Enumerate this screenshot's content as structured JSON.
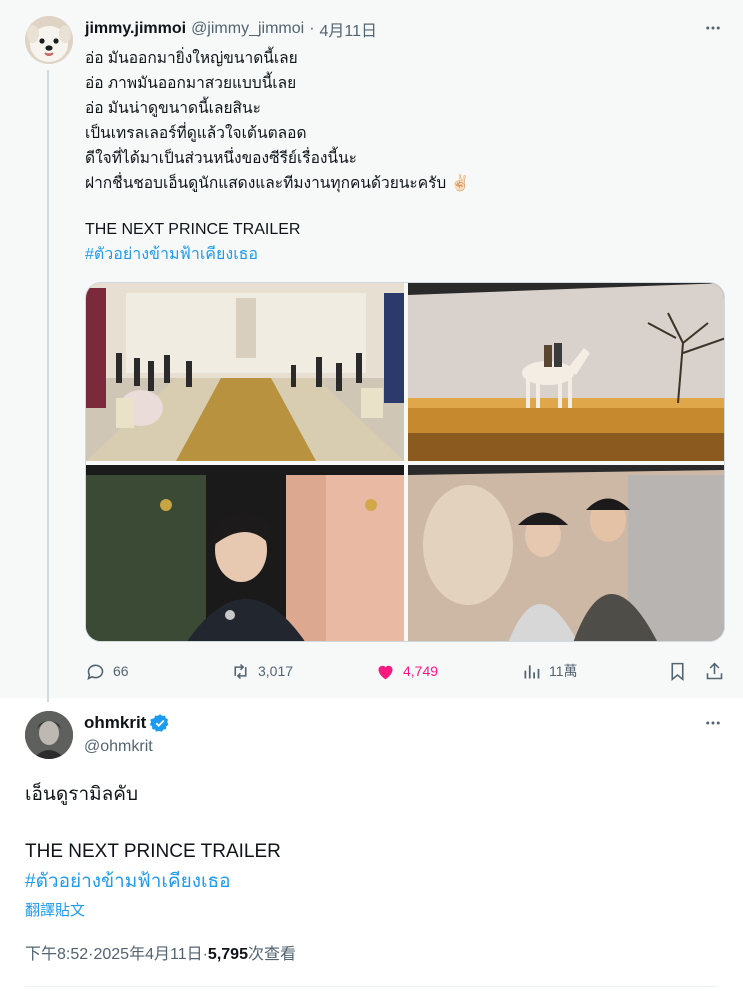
{
  "parent": {
    "name": "jimmy.jimmoi",
    "handle": "@jimmy_jimmoi",
    "separator": "·",
    "date": "4月11日",
    "more_icon": "more-horizontal-icon",
    "lines": [
      "อ่อ มันออกมายิ่งใหญ่ขนาดนี้เลย",
      "อ่อ ภาพมันออกมาสวยแบบนี้เลย",
      "อ่อ มันน่าดูขนาดนี้เลยสินะ",
      "เป็นเทรลเลอร์ที่ดูแล้วใจเต้นตลอด",
      "ดีใจที่ได้มาเป็นส่วนหนึ่งของซีรีย์เรื่องนี้นะ",
      "ฝากชื่นชอบเอ็นดูนักแสดงและทีมงานทุกคนด้วยนะครับ"
    ],
    "emoji": "✌🏻",
    "trailer": "THE NEXT PRINCE TRAILER",
    "hashtag": "#ตัวอย่างข้ามฟ้าเคียงเธอ",
    "media": [
      "palace-hall-photo",
      "horse-sunset-photo",
      "prince-portrait-photo",
      "embrace-scene-photo"
    ],
    "stats": {
      "replies": "66",
      "retweets": "3,017",
      "likes": "4,749",
      "views": "11萬"
    }
  },
  "main": {
    "name": "ohmkrit",
    "verified": true,
    "handle": "@ohmkrit",
    "text": "เอ็นดูรามิลคับ",
    "trailer": "THE NEXT PRINCE TRAILER",
    "hashtag": "#ตัวอย่างข้ามฟ้าเคียงเธอ",
    "translate": "翻譯貼文",
    "time": "下午8:52",
    "dot": " · ",
    "date": "2025年4月11日",
    "dot2": " · ",
    "views_count": "5,795",
    "views_label": " 次查看"
  },
  "colors": {
    "accent": "#1d9bf0",
    "like": "#f91880",
    "muted": "#536471"
  }
}
